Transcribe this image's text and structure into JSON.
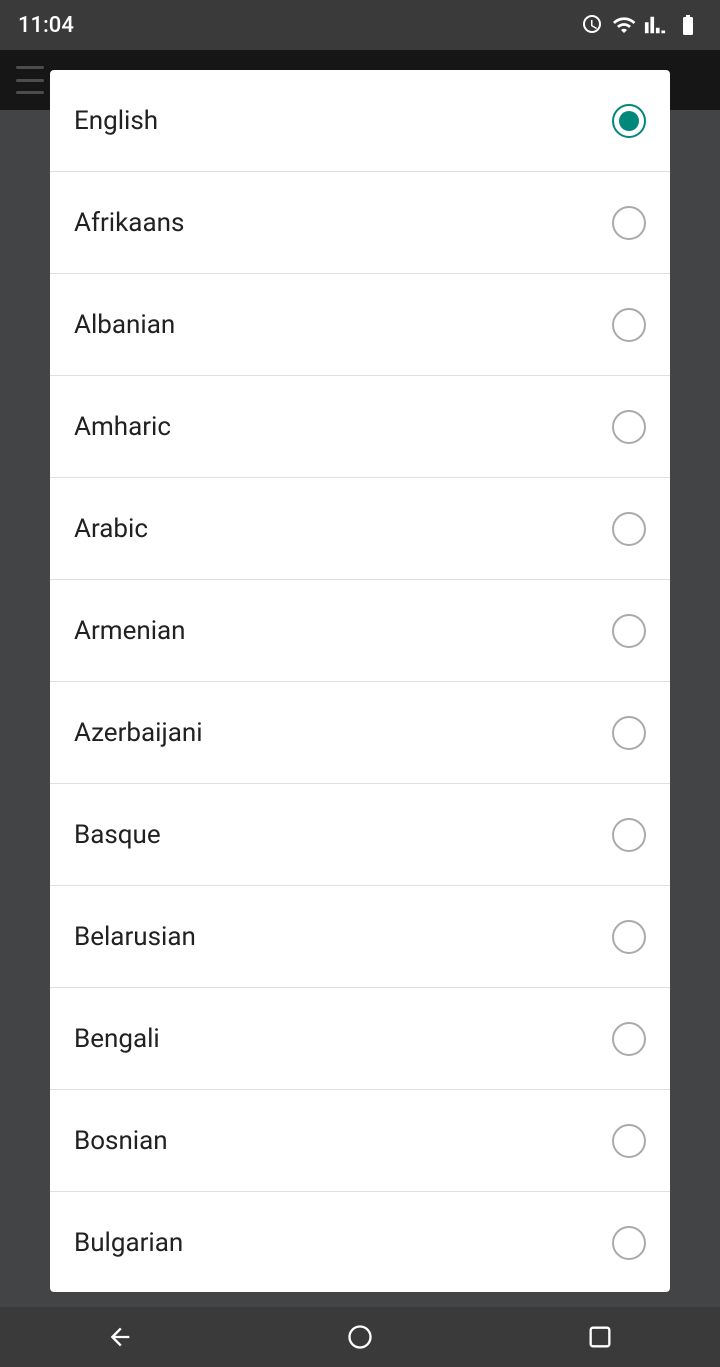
{
  "statusBar": {
    "time": "11:04"
  },
  "dialog": {
    "languages": [
      {
        "id": "english",
        "label": "English",
        "selected": true
      },
      {
        "id": "afrikaans",
        "label": "Afrikaans",
        "selected": false
      },
      {
        "id": "albanian",
        "label": "Albanian",
        "selected": false
      },
      {
        "id": "amharic",
        "label": "Amharic",
        "selected": false
      },
      {
        "id": "arabic",
        "label": "Arabic",
        "selected": false
      },
      {
        "id": "armenian",
        "label": "Armenian",
        "selected": false
      },
      {
        "id": "azerbaijani",
        "label": "Azerbaijani",
        "selected": false
      },
      {
        "id": "basque",
        "label": "Basque",
        "selected": false
      },
      {
        "id": "belarusian",
        "label": "Belarusian",
        "selected": false
      },
      {
        "id": "bengali",
        "label": "Bengali",
        "selected": false
      },
      {
        "id": "bosnian",
        "label": "Bosnian",
        "selected": false
      },
      {
        "id": "bulgarian",
        "label": "Bulgarian",
        "selected": false
      }
    ]
  },
  "navBar": {
    "back": "◁",
    "home": "○",
    "recents": "□"
  }
}
